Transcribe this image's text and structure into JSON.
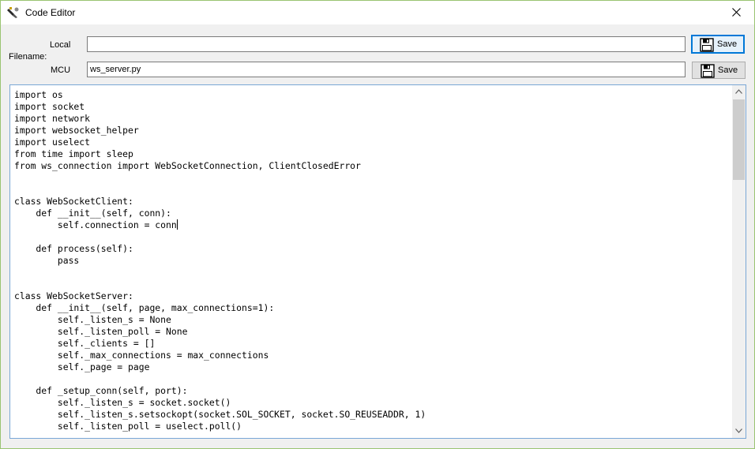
{
  "window": {
    "title": "Code Editor"
  },
  "filename": {
    "group_label": "Filename:",
    "local_label": "Local",
    "local_value": "",
    "mcu_label": "MCU",
    "mcu_value": "ws_server.py"
  },
  "buttons": {
    "save_local": "Save",
    "save_mcu": "Save"
  },
  "editor": {
    "lines": [
      "import os",
      "import socket",
      "import network",
      "import websocket_helper",
      "import uselect",
      "from time import sleep",
      "from ws_connection import WebSocketConnection, ClientClosedError",
      "",
      "",
      "class WebSocketClient:",
      "    def __init__(self, conn):",
      "        self.connection = conn",
      "",
      "    def process(self):",
      "        pass",
      "",
      "",
      "class WebSocketServer:",
      "    def __init__(self, page, max_connections=1):",
      "        self._listen_s = None",
      "        self._listen_poll = None",
      "        self._clients = []",
      "        self._max_connections = max_connections",
      "        self._page = page",
      "",
      "    def _setup_conn(self, port):",
      "        self._listen_s = socket.socket()",
      "        self._listen_s.setsockopt(socket.SOL_SOCKET, socket.SO_REUSEADDR, 1)",
      "        self._listen_poll = uselect.poll()"
    ],
    "caret_line": 11
  },
  "icons": {
    "title": "editor-app-icon",
    "close": "close-icon",
    "save": "floppy-disk-icon",
    "scroll_up": "chevron-up-icon",
    "scroll_down": "chevron-down-icon"
  },
  "colors": {
    "window_border": "#9ac472",
    "focus_blue": "#0078d7",
    "editor_border": "#7aa7d6"
  }
}
